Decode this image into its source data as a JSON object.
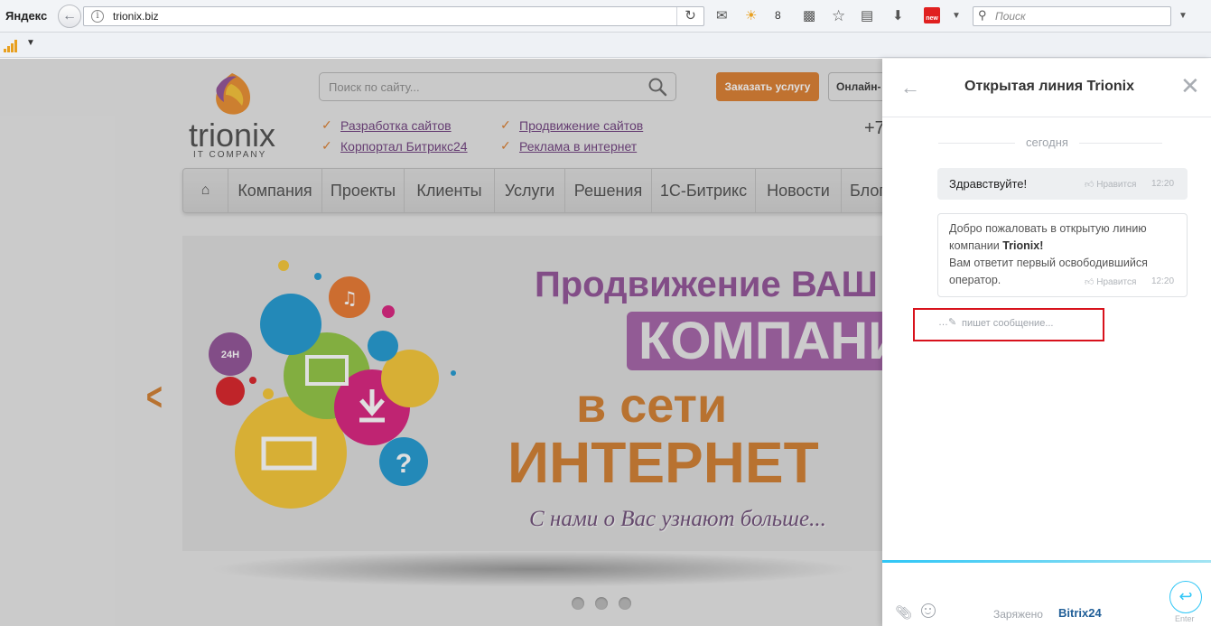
{
  "browser": {
    "brand": "Яндекс",
    "url": "trionix.biz",
    "weather_temp": "8",
    "new_badge": "new",
    "search_placeholder": "Поиск"
  },
  "site": {
    "logo_word": "trionix",
    "logo_sub": "IT COMPANY",
    "search_placeholder": "Поиск по сайту...",
    "order_button": "Заказать услугу",
    "online_button": "Онлайн-",
    "phone_fragment": "+7",
    "services": [
      "Разработка сайтов",
      "Продвижение сайтов",
      "Корпортал Битрикс24",
      "Реклама в интернет"
    ],
    "nav": [
      "Компания",
      "Проекты",
      "Клиенты",
      "Услуги",
      "Решения",
      "1С-Битрикс",
      "Новости",
      "Блог"
    ],
    "banner": {
      "line1": "Продвижение ВАШ",
      "line2": "КОМПАНИ",
      "line3": "в сети",
      "line4": "ИНТЕРНЕТ",
      "line5": "С нами о Вас узнают больше...",
      "badge_24": "24H"
    },
    "colors": {
      "accent_orange": "#d97a2a",
      "accent_purple": "#8e4e94"
    }
  },
  "chat": {
    "title": "Открытая линия Trionix",
    "date_label": "сегодня",
    "messages": [
      {
        "text": "Здравствуйте!",
        "like": "Нравится",
        "time": "12:20"
      },
      {
        "line1": "Добро пожаловать в открытую линию",
        "line2_prefix": "компании ",
        "line2_bold": "Trionix!",
        "line3": "Вам ответит первый освободившийся",
        "line4": "оператор.",
        "like": "Нравится",
        "time": "12:20"
      }
    ],
    "typing": "пишет сообщение...",
    "powered_by": "Заряжено",
    "bitrix_a": "Bitrix",
    "bitrix_b": "24",
    "enter_label": "Enter",
    "colors": {
      "accent": "#2fc6f6",
      "highlight": "#d8121c"
    }
  }
}
